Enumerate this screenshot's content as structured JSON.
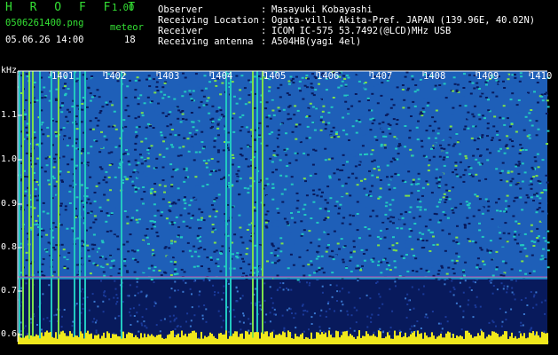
{
  "header": {
    "logo": "H R O F F T",
    "version": "1.00",
    "filename": "0506261400.png",
    "datetime": "05.06.26 14:00",
    "meteor_label": "meteor",
    "meteor_count": "18"
  },
  "info": {
    "rows": [
      {
        "label": "Observer",
        "sep": ":",
        "value": "Masayuki Kobayashi"
      },
      {
        "label": "Receiving Location",
        "sep": ":",
        "value": "Ogata-vill. Akita-Pref. JAPAN (139.96E, 40.02N)"
      },
      {
        "label": "Receiver",
        "sep": ":",
        "value": "ICOM IC-575 53.7492(@LCD)MHz USB"
      },
      {
        "label": "Receiving antenna",
        "sep": ":",
        "value": "A504HB(yagi 4el)"
      }
    ]
  },
  "spectrogram": {
    "y_unit": "kHz",
    "y_ticks": [
      "1.1",
      "1.0",
      "0.9",
      "0.8",
      "0.7",
      "0.6"
    ],
    "x_ticks": [
      "1401",
      "1402",
      "1403",
      "1404",
      "1405",
      "1406",
      "1407",
      "1408",
      "1409",
      "1410"
    ],
    "colors": {
      "background": "#000000",
      "low": "#081a5c",
      "mid": "#1e5fb8",
      "high": "#22c8c0",
      "peak": "#7ee04a",
      "baseline": "#f0e81c",
      "header_green": "#34e034"
    }
  }
}
